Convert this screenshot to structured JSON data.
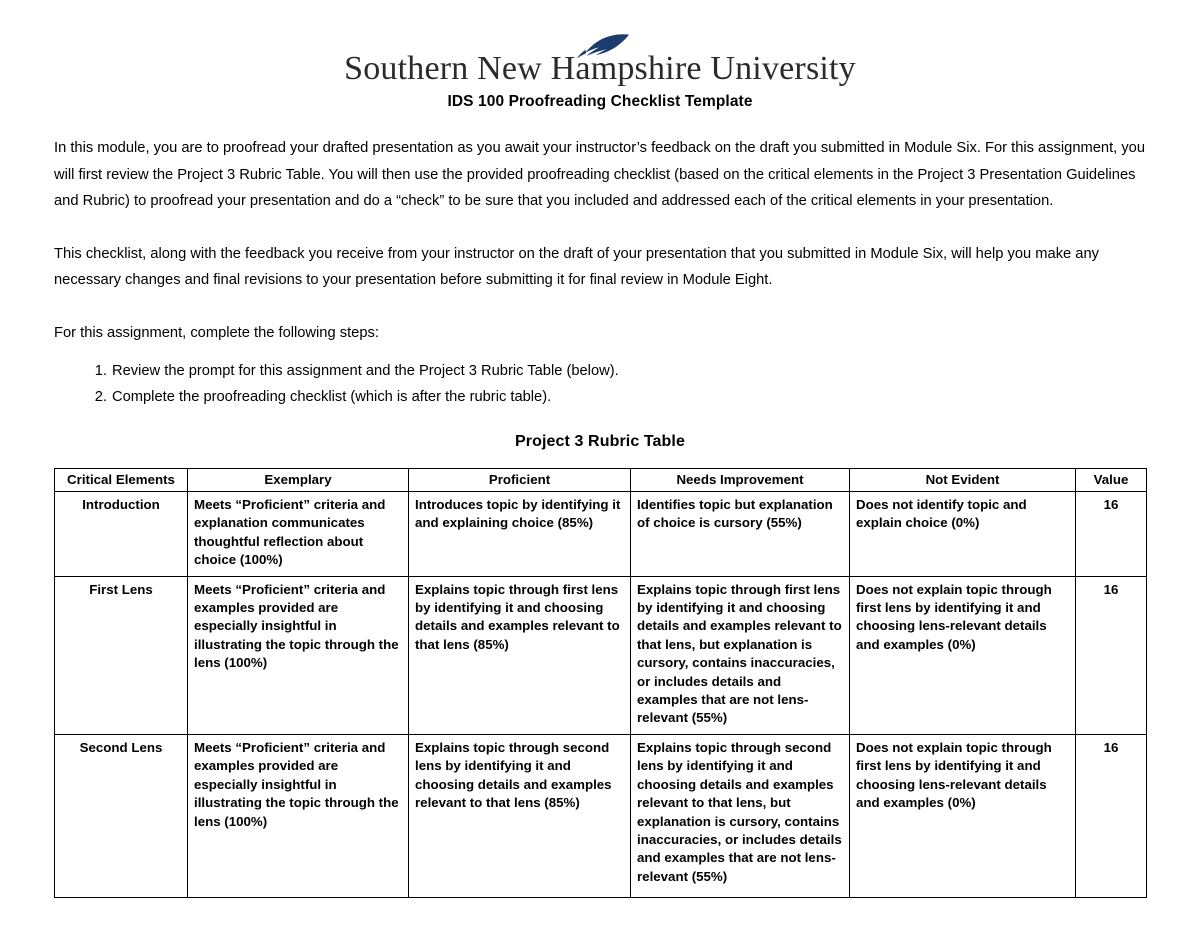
{
  "header": {
    "logo_text": "Southern New Hampshire University",
    "logo_icon": "feather-quill-icon",
    "logo_color": "#1c3c6e",
    "title": "IDS 100 Proofreading Checklist Template"
  },
  "body": {
    "paragraph_1": "In this module, you are to proofread your drafted presentation as you await your instructor’s feedback on the draft you submitted in Module Six. For this assignment, you will first review the Project 3 Rubric Table. You will then use the provided proofreading checklist (based on the critical elements in the Project 3 Presentation Guidelines and Rubric) to proofread your presentation and do a “check” to be sure that you included and addressed each of the critical elements in your presentation.",
    "paragraph_2": "This checklist, along with the feedback you receive from your instructor on the draft of your presentation that you submitted in Module Six, will help you make any necessary changes and final revisions to your presentation before submitting it for final review in Module Eight.",
    "paragraph_3": "For this assignment, complete the following steps:",
    "steps": [
      {
        "number": "1.",
        "text": "Review the prompt for this assignment and the Project 3 Rubric Table (below)."
      },
      {
        "number": "2.",
        "text": "Complete the proofreading checklist (which is after the rubric table)."
      }
    ]
  },
  "rubric": {
    "heading": "Project 3 Rubric Table",
    "columns": [
      "Critical Elements",
      "Exemplary",
      "Proficient",
      "Needs Improvement",
      "Not Evident",
      "Value"
    ],
    "rows": [
      {
        "element": "Introduction",
        "exemplary": "Meets “Proficient” criteria and explanation communicates thoughtful reflection about choice (100%)",
        "proficient": "Introduces topic by identifying it and explaining choice (85%)",
        "needs_improvement": "Identifies topic but explanation of choice is cursory (55%)",
        "not_evident": "Does not identify topic and explain choice (0%)",
        "value": "16"
      },
      {
        "element": "First Lens",
        "exemplary": "Meets “Proficient” criteria and examples provided are especially insightful in illustrating the topic through the lens (100%)",
        "proficient": "Explains topic through first lens by identifying it and choosing details and examples relevant to that lens (85%)",
        "needs_improvement": "Explains topic through first lens by identifying it and choosing details and examples relevant to that lens, but explanation is cursory, contains inaccuracies, or includes details and examples that are not lens-relevant (55%)",
        "not_evident": "Does not explain topic through first lens by identifying it and choosing lens-relevant details and examples (0%)",
        "value": "16"
      },
      {
        "element": "Second Lens",
        "exemplary": "Meets “Proficient” criteria and examples provided are especially insightful in illustrating the topic through the lens (100%)",
        "proficient": "Explains topic through second lens by identifying it and choosing details and examples relevant to that lens (85%)",
        "needs_improvement": "Explains topic through second lens by identifying it and choosing details and examples relevant to that lens, but explanation is cursory, contains inaccuracies, or includes details and examples that are not lens-relevant (55%)",
        "not_evident": "Does not explain topic through first lens by identifying it and choosing lens-relevant details and examples (0%)",
        "value": "16"
      }
    ]
  }
}
